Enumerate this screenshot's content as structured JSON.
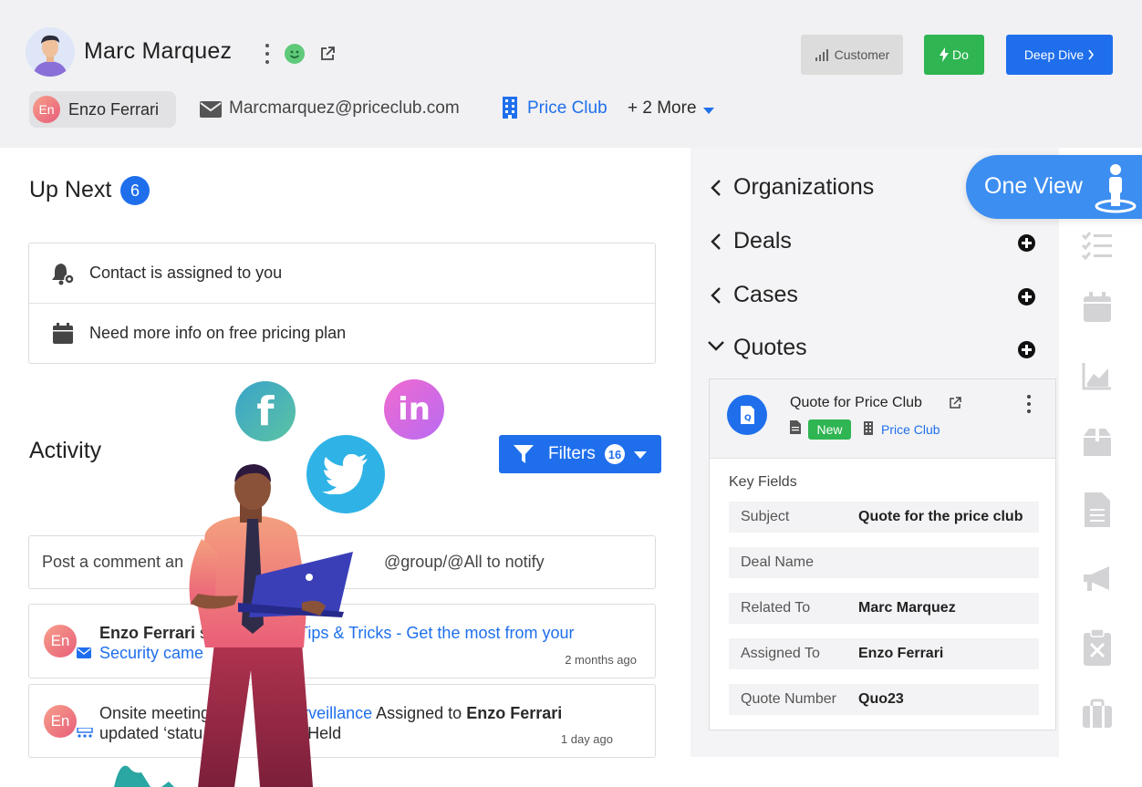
{
  "header": {
    "contact_name": "Marc Marquez",
    "buttons": {
      "customer": "Customer",
      "do": "Do",
      "deep_dive": "Deep Dive"
    },
    "owner": {
      "initials": "En",
      "name": "Enzo Ferrari"
    },
    "email": "Marcmarquez@priceclub.com",
    "organization": "Price Club",
    "more": "+ 2 More"
  },
  "up_next": {
    "title": "Up Next",
    "count": "6",
    "items": [
      {
        "icon": "bell-gear-icon",
        "text": "Contact is assigned to you"
      },
      {
        "icon": "calendar-icon",
        "text": "Need more info on free pricing plan"
      }
    ]
  },
  "activity": {
    "title": "Activity",
    "filters_label": "Filters",
    "filters_count": "16",
    "comment_placeholder_start": "Post a comment an",
    "comment_placeholder_end": "@group/@All to notify",
    "feed": [
      {
        "initials": "En",
        "actor": "Enzo Ferrari",
        "verb": "se",
        "link": "Tips & Tricks - Get the most from your",
        "link_cont": "Security came",
        "time": "2 months ago"
      },
      {
        "initials": "En",
        "pre": "Onsite meeting",
        "link": "urveillance",
        "mid": "Assigned to",
        "assignee": "Enzo Ferrari",
        "line2_a": "updated ‘statu",
        "line2_b": "to Held",
        "time": "1 day ago"
      }
    ]
  },
  "related": {
    "sections": [
      {
        "label": "Organizations",
        "expanded": false,
        "add": false
      },
      {
        "label": "Deals",
        "expanded": false,
        "add": true
      },
      {
        "label": "Cases",
        "expanded": false,
        "add": true
      },
      {
        "label": "Quotes",
        "expanded": true,
        "add": true
      }
    ],
    "quote": {
      "title": "Quote for Price Club",
      "status": "New",
      "organization": "Price Club",
      "key_fields_label": "Key Fields",
      "fields": [
        {
          "key": "Subject",
          "value": "Quote for the price club"
        },
        {
          "key": "Deal Name",
          "value": ""
        },
        {
          "key": "Related To",
          "value": "Marc Marquez"
        },
        {
          "key": "Assigned To",
          "value": "Enzo Ferrari"
        },
        {
          "key": "Quote Number",
          "value": "Quo23"
        }
      ]
    }
  },
  "one_view": {
    "label": "One View"
  },
  "rail_icons": [
    "checklist-icon",
    "calendar-icon",
    "chart-icon",
    "box-icon",
    "document-icon",
    "megaphone-icon",
    "clipboard-icon",
    "briefcase-icon"
  ],
  "colors": {
    "primary": "#1f6fec",
    "success": "#2fb552",
    "header_bg": "#f1f1f3",
    "panel_bg": "#f4f4f6"
  }
}
